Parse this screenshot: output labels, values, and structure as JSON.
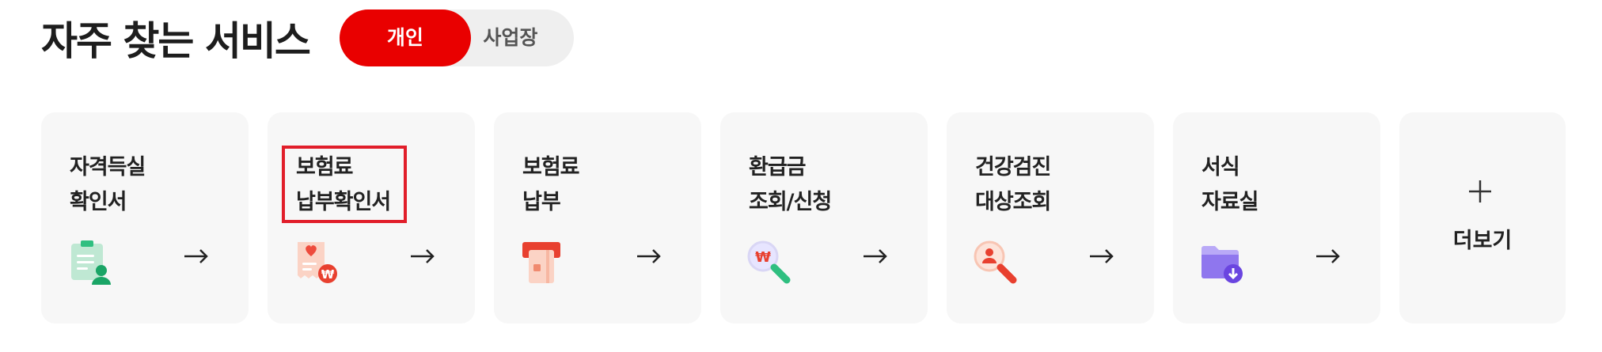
{
  "section_title": "자주 찾는 서비스",
  "toggle": {
    "personal": "개인",
    "business": "사업장",
    "selected": "personal"
  },
  "cards": [
    {
      "line1": "자격득실",
      "line2": "확인서",
      "icon": "id-document-icon"
    },
    {
      "line1": "보험료",
      "line2": "납부확인서",
      "icon": "receipt-won-icon",
      "highlighted": true
    },
    {
      "line1": "보험료",
      "line2": "납부",
      "icon": "card-payment-icon"
    },
    {
      "line1": "환급금",
      "line2": "조회/신청",
      "icon": "magnifier-won-icon"
    },
    {
      "line1": "건강검진",
      "line2": "대상조회",
      "icon": "magnifier-person-icon"
    },
    {
      "line1": "서식",
      "line2": "자료실",
      "icon": "folder-download-icon"
    }
  ],
  "more": {
    "label": "더보기",
    "icon": "plus-icon"
  },
  "arrow_icon": "arrow-right-icon",
  "colors": {
    "accent": "#e90000",
    "highlight_border": "#e11e2a",
    "card_bg": "#f7f7f7"
  }
}
